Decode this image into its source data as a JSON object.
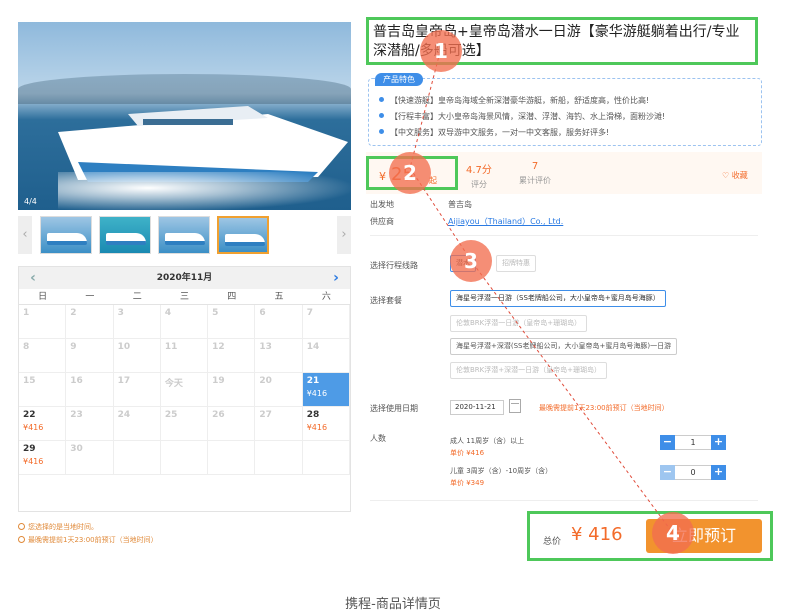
{
  "gallery": {
    "counter": "4/4",
    "prev_arrow": "‹",
    "next_arrow": "›"
  },
  "calendar": {
    "month_title": "2020年11月",
    "prev": "‹",
    "next": "›",
    "weekdays": [
      "日",
      "一",
      "二",
      "三",
      "四",
      "五",
      "六"
    ],
    "days": [
      {
        "d": "1",
        "p": ""
      },
      {
        "d": "2",
        "p": ""
      },
      {
        "d": "3",
        "p": ""
      },
      {
        "d": "4",
        "p": ""
      },
      {
        "d": "5",
        "p": ""
      },
      {
        "d": "6",
        "p": ""
      },
      {
        "d": "7",
        "p": ""
      },
      {
        "d": "8",
        "p": ""
      },
      {
        "d": "9",
        "p": ""
      },
      {
        "d": "10",
        "p": ""
      },
      {
        "d": "11",
        "p": ""
      },
      {
        "d": "12",
        "p": ""
      },
      {
        "d": "13",
        "p": ""
      },
      {
        "d": "14",
        "p": ""
      },
      {
        "d": "15",
        "p": ""
      },
      {
        "d": "16",
        "p": ""
      },
      {
        "d": "17",
        "p": ""
      },
      {
        "d": "今天",
        "p": ""
      },
      {
        "d": "19",
        "p": ""
      },
      {
        "d": "20",
        "p": ""
      },
      {
        "d": "21",
        "p": "¥416",
        "state": "selected"
      },
      {
        "d": "22",
        "p": "¥416",
        "state": "available"
      },
      {
        "d": "23",
        "p": ""
      },
      {
        "d": "24",
        "p": ""
      },
      {
        "d": "25",
        "p": ""
      },
      {
        "d": "26",
        "p": ""
      },
      {
        "d": "27",
        "p": ""
      },
      {
        "d": "28",
        "p": "¥416",
        "state": "available"
      },
      {
        "d": "29",
        "p": "¥416",
        "state": "available"
      },
      {
        "d": "30",
        "p": ""
      },
      {
        "d": "",
        "p": ""
      },
      {
        "d": "",
        "p": ""
      },
      {
        "d": "",
        "p": ""
      },
      {
        "d": "",
        "p": ""
      },
      {
        "d": "",
        "p": ""
      }
    ]
  },
  "notes": [
    "您选择的是当地时间。",
    "最晚需提前1天23:00前预订（当地时间）"
  ],
  "product": {
    "title": "普吉岛皇帝岛+皇帝岛潜水一日游【豪华游艇躺着出行/专业深潜船/多船可选】",
    "features_tag": "产品特色",
    "features": [
      "【快速游艇】皇帝岛海域全新深潜豪华游艇，新船，舒适度高，性价比高!",
      "【行程丰富】大小皇帝岛海景风情，深潜、浮潜、海钓、水上滑梯，面粉沙滩!",
      "【中文服务】双导游中文服务，一对一中文客服，服务好评多!"
    ]
  },
  "price": {
    "currency": "¥",
    "value": "25",
    "suffix": "起"
  },
  "stats": [
    {
      "value": "4.7分",
      "label": "评分"
    },
    {
      "value": "7",
      "label": "累计评价"
    }
  ],
  "favorite_label": "收藏",
  "info": {
    "departure_label": "出发地",
    "departure_value": "普吉岛",
    "supplier_label": "供应商",
    "supplier_value": "Aijiayou（Thailand）Co., Ltd."
  },
  "route": {
    "label": "选择行程线路",
    "options": [
      "潜水",
      "招牌特惠"
    ]
  },
  "package": {
    "label": "选择套餐",
    "options": [
      "海星号浮潜一日游（SS老牌船公司，大小皇帝岛+蜜月岛号海豚）",
      "伦敦BRK浮潜一日游（皇帝岛+珊瑚岛）",
      "海星号浮潜+深潜(SS老牌船公司，大小皇帝岛+蜜月岛号海豚)一日游",
      "伦敦BRK浮潜+深潜一日游（皇帝岛+珊瑚岛）"
    ]
  },
  "date": {
    "label": "选择使用日期",
    "value": "2020-11-21",
    "note": "最晚需提前1天23:00前预订（当地时间）"
  },
  "people": {
    "label": "人数",
    "adult": {
      "desc": "成人  11周岁（含）以上",
      "price": "单价 ¥416",
      "count": "1"
    },
    "child": {
      "desc": "儿童  3周岁（含）-10周岁（含）",
      "price": "单价 ¥349",
      "count": "0"
    }
  },
  "total": {
    "label": "总价",
    "value": "¥ 416",
    "button": "立即预订"
  },
  "markers": [
    "1",
    "2",
    "3",
    "4"
  ],
  "caption": "携程-商品详情页",
  "colors": {
    "accent": "#f36b2a",
    "blue": "#3e8ee8",
    "highlight": "#4ec85a",
    "marker": "#f26e50"
  }
}
